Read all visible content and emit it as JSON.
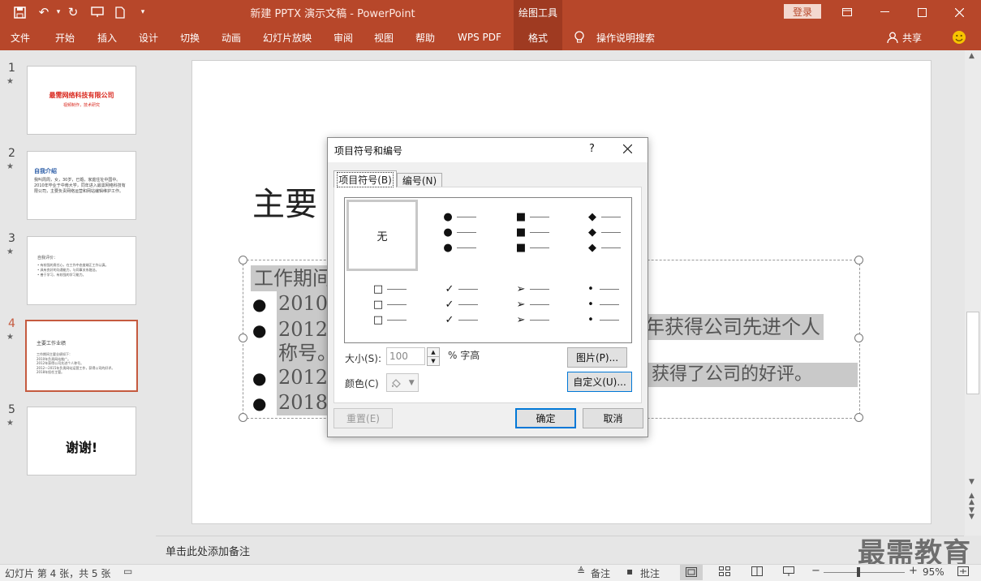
{
  "app": {
    "title": "新建 PPTX 演示文稿 - PowerPoint",
    "context_tab": "绘图工具",
    "login": "登录"
  },
  "menu": {
    "items": [
      "文件",
      "开始",
      "插入",
      "设计",
      "切换",
      "动画",
      "幻灯片放映",
      "审阅",
      "视图",
      "帮助",
      "WPS PDF"
    ],
    "format": "格式",
    "tell_me": "操作说明搜索",
    "share": "共享"
  },
  "thumbnails": [
    {
      "number": "1",
      "title": "最需网络科技有限公司",
      "subtitle": "视频制作，技术研究"
    },
    {
      "number": "2",
      "title": "自我介绍",
      "body": "我叫周周，女，30岁，已婚，家庭住址中国中。2010年毕业于中南大学，同年进入最需网络科技有限公司，主要负责网络运营和网站编辑维护工作。"
    },
    {
      "number": "3",
      "title": "自我评价：",
      "lines": [
        "• 有较强的责任心，在工作中态度端正工作认真。",
        "• 具有良好的沟通能力，与同事关系融洽。",
        "• 善于学习，有较强的学习能力。"
      ]
    },
    {
      "number": "4",
      "title": "主要工作业绩",
      "lines": [
        "工作期间主要业绩如下：",
        "2010年负责网站推广。",
        "2012年获得公司先进个人称号。",
        "2012—2015年负责网站运营工作，获得公司的好评。",
        "2018年担任主管。"
      ]
    },
    {
      "number": "5",
      "title": "谢谢!"
    }
  ],
  "slide": {
    "title_partial": "主要",
    "body_lines": [
      "工作期间",
      "2010负",
      "2012年",
      "称号。",
      "2012-",
      "2018年"
    ],
    "right_fragments": [
      "年获得公司先进个人",
      "获得了公司的好评。"
    ]
  },
  "notes": {
    "placeholder": "单击此处添加备注"
  },
  "status": {
    "slide_info": "幻灯片 第 4 张，共 5 张",
    "notes_label": "备注",
    "comments_label": "批注",
    "zoom": "95%"
  },
  "dialog": {
    "title": "项目符号和编号",
    "help": "?",
    "tabs": [
      "项目符号(B)",
      "编号(N)"
    ],
    "none_label": "无",
    "bullet_glyphs": [
      "●",
      "■",
      "◆",
      "□",
      "✓",
      "➢",
      "•"
    ],
    "size_label": "大小(S):",
    "size_value": "100",
    "size_unit": "% 字高",
    "color_label": "颜色(C)",
    "picture_btn": "图片(P)...",
    "custom_btn": "自定义(U)...",
    "reset_btn": "重置(E)",
    "ok_btn": "确定",
    "cancel_btn": "取消"
  },
  "watermark": "最需教育",
  "colors": {
    "accent": "#b7472a",
    "accent_dark": "#9f3a21",
    "selected_border": "#c55a3f"
  }
}
